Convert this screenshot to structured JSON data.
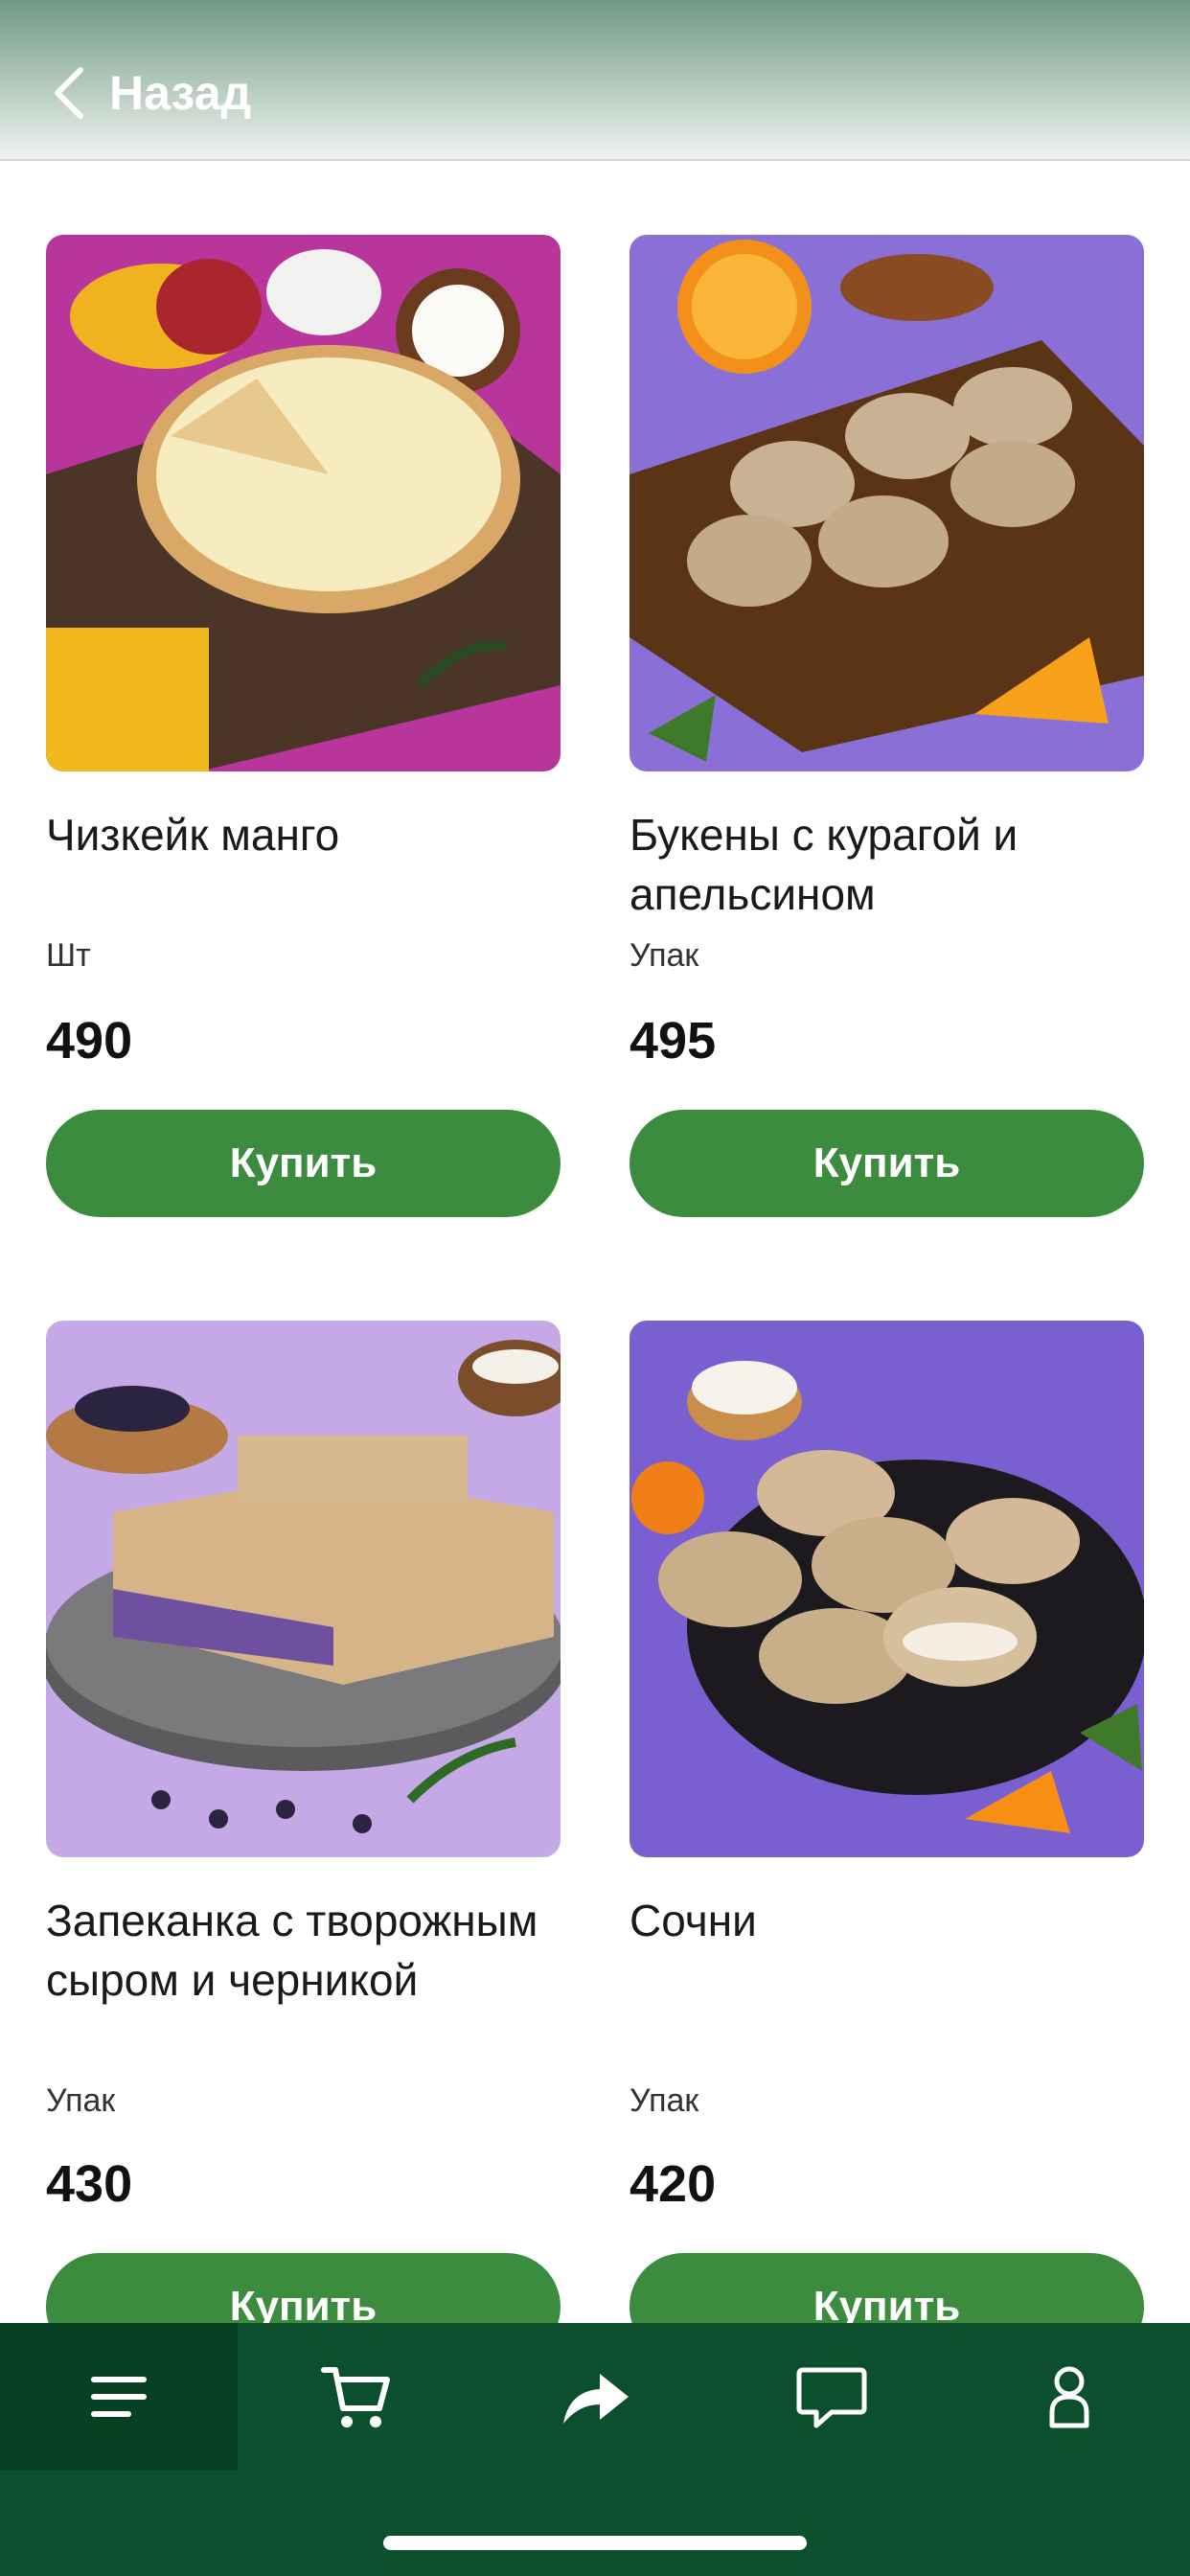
{
  "header": {
    "back_label": "Назад"
  },
  "products": [
    {
      "name": "Чизкейк манго",
      "unit": "Шт",
      "price": "490",
      "buy_label": "Купить",
      "bg": "#b8359c"
    },
    {
      "name": "Букены с курагой и апельсином",
      "unit": "Упак",
      "price": "495",
      "buy_label": "Купить",
      "bg": "#8a6fd6"
    },
    {
      "name": "Запеканка с творожным сыром и черникой",
      "unit": "Упак",
      "price": "430",
      "buy_label": "Купить",
      "bg": "#c4a9e6"
    },
    {
      "name": "Сочни",
      "unit": "Упак",
      "price": "420",
      "buy_label": "Купить",
      "bg": "#7a5fd0"
    }
  ],
  "tabbar": {
    "items": [
      {
        "icon": "menu-icon",
        "active": true
      },
      {
        "icon": "cart-icon",
        "active": false
      },
      {
        "icon": "share-icon",
        "active": false
      },
      {
        "icon": "chat-icon",
        "active": false
      },
      {
        "icon": "profile-icon",
        "active": false
      }
    ],
    "colors": {
      "background": "#0b4f2c",
      "active": "#084023"
    }
  },
  "colors": {
    "accent": "#3b8c3f"
  }
}
